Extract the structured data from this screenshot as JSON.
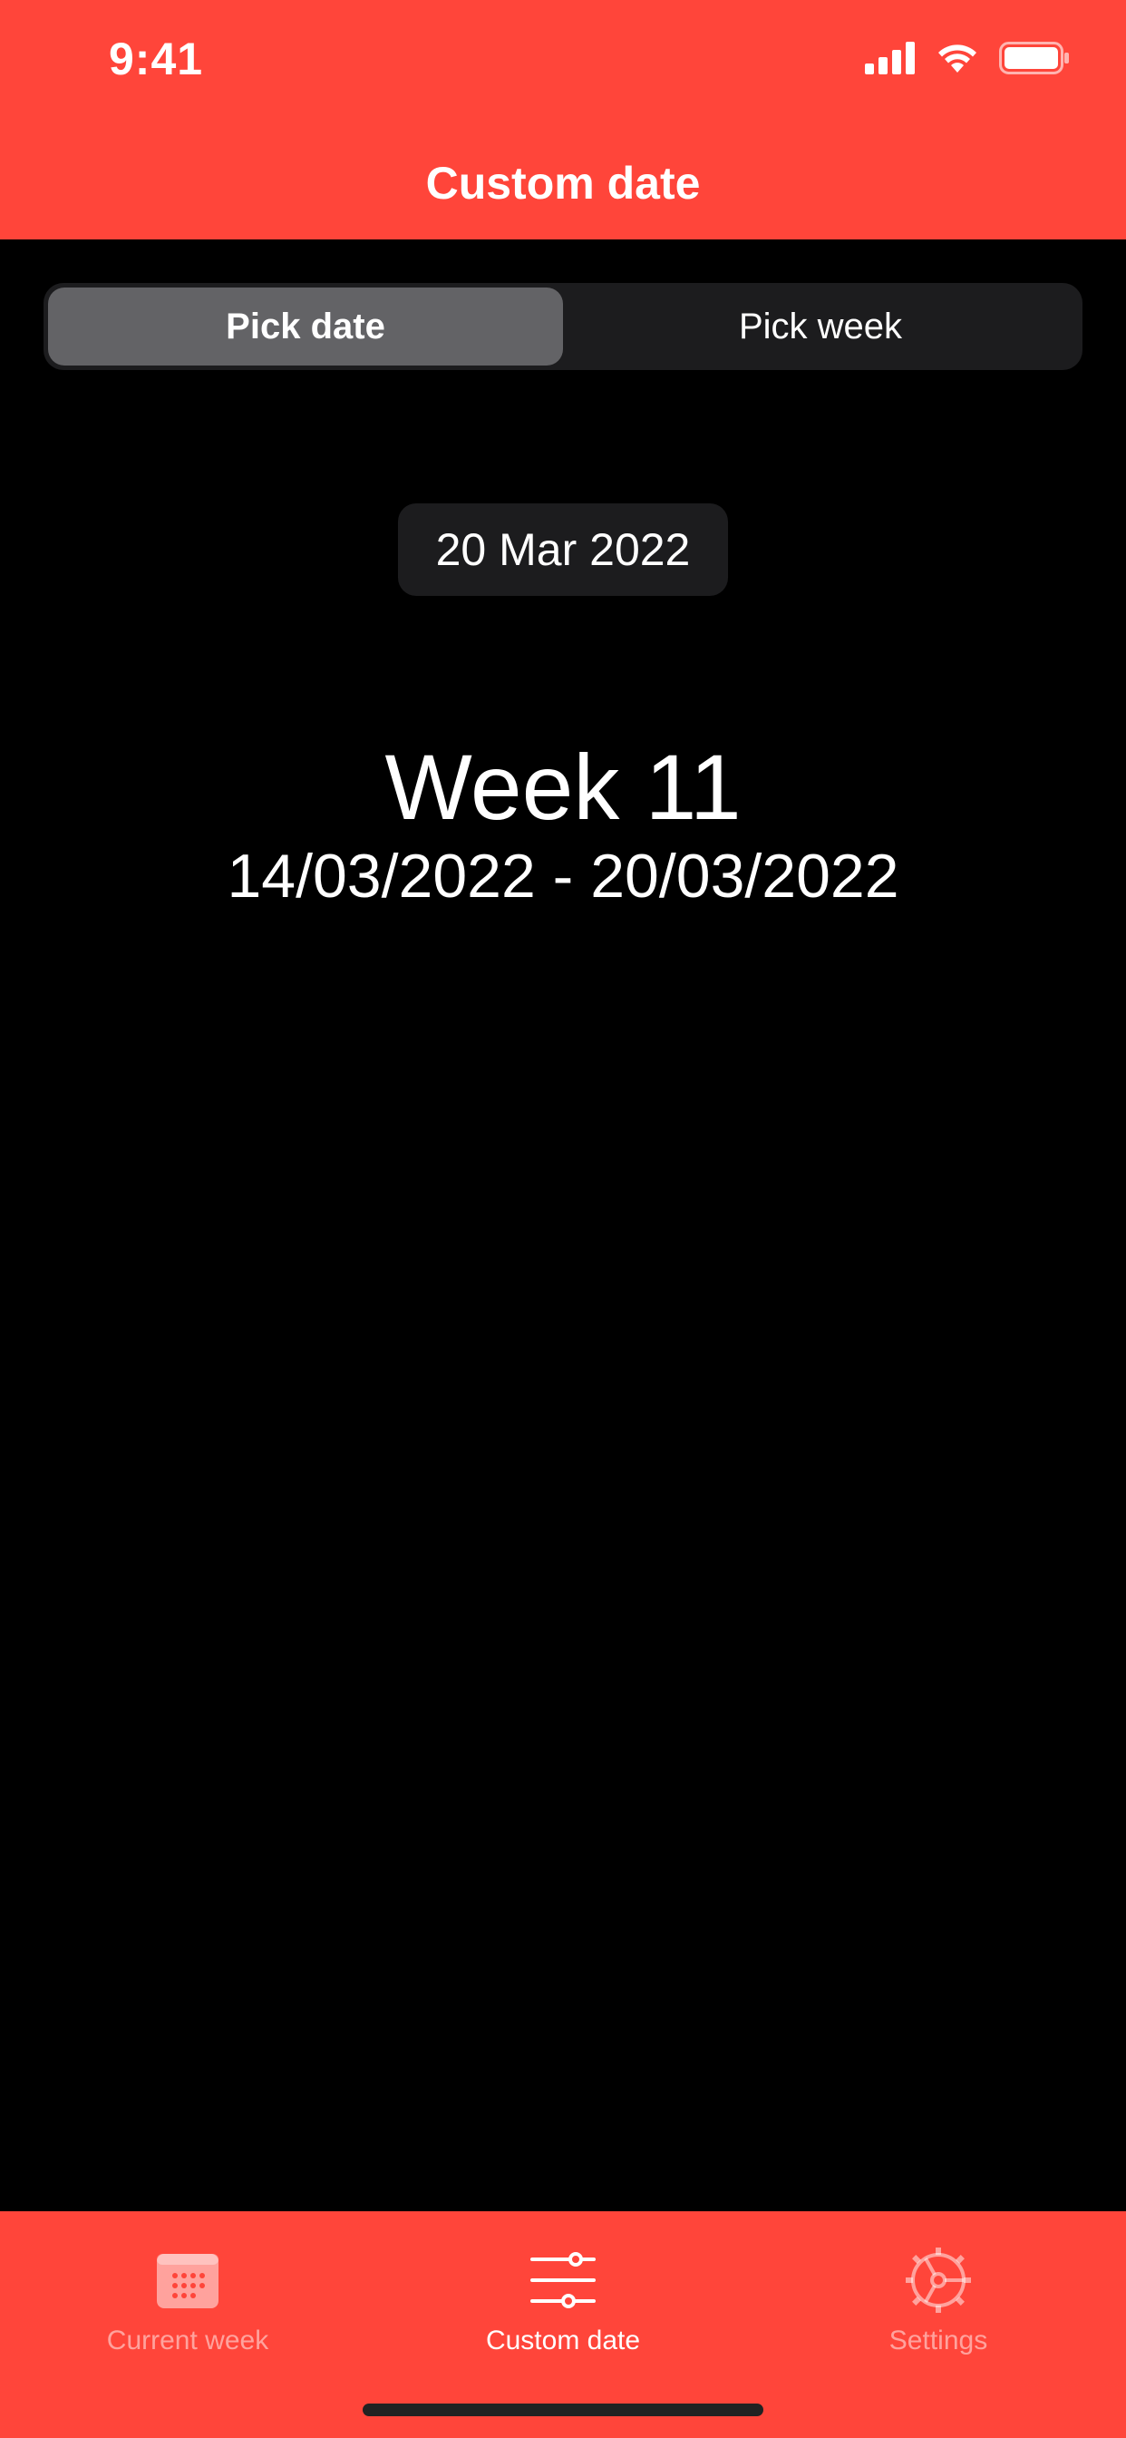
{
  "status_bar": {
    "time": "9:41"
  },
  "nav": {
    "title": "Custom date"
  },
  "segmented": {
    "pick_date": "Pick date",
    "pick_week": "Pick week",
    "selected": "Pick date"
  },
  "date_picker": {
    "value": "20 Mar 2022"
  },
  "week": {
    "title": "Week 11",
    "range": "14/03/2022 - 20/03/2022"
  },
  "tab_bar": {
    "items": [
      {
        "label": "Current week",
        "icon": "calendar-icon",
        "active": false
      },
      {
        "label": "Custom date",
        "icon": "sliders-icon",
        "active": true
      },
      {
        "label": "Settings",
        "icon": "gear-icon",
        "active": false
      }
    ]
  },
  "colors": {
    "accent": "#FF453A",
    "surface": "#1C1C1E",
    "segment_selected": "#636366",
    "background": "#000000"
  }
}
